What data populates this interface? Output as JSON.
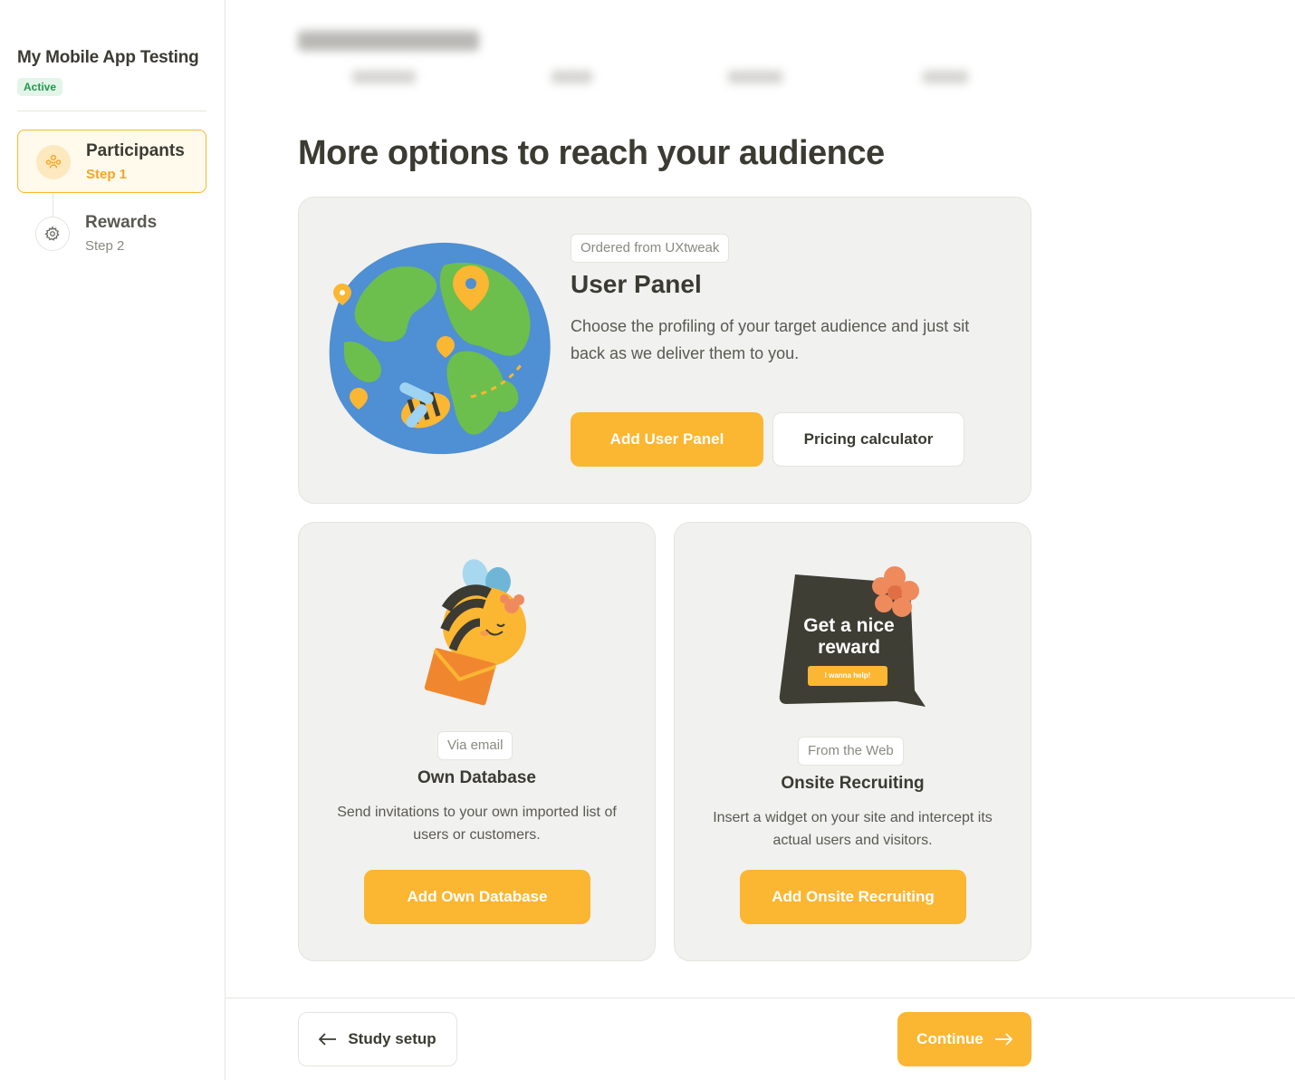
{
  "sidebar": {
    "study_title": "My Mobile App Testing",
    "status": "Active",
    "steps": [
      {
        "name": "Participants",
        "sub": "Step 1",
        "icon": "people-icon",
        "active": true
      },
      {
        "name": "Rewards",
        "sub": "Step 2",
        "icon": "gear-icon",
        "active": false
      }
    ]
  },
  "main": {
    "heading": "More options to reach your audience",
    "user_panel": {
      "tag": "Ordered from UXtweak",
      "title": "User Panel",
      "description": "Choose the profiling of your target audience and just sit back as we deliver them to you.",
      "primary_button": "Add User Panel",
      "secondary_button": "Pricing calculator"
    },
    "own_database": {
      "tag": "Via email",
      "title": "Own Database",
      "description": "Send invitations to your own imported list of users or customers.",
      "button": "Add Own Database"
    },
    "onsite": {
      "tag": "From the Web",
      "title": "Onsite Recruiting",
      "description": "Insert a widget on your site and intercept its actual users and visitors.",
      "button": "Add Onsite Recruiting",
      "illustration_text": "Get a nice reward",
      "illustration_button": "I wanna help!"
    }
  },
  "footer": {
    "back_label": "Study setup",
    "continue_label": "Continue"
  },
  "colors": {
    "accent": "#fbb632",
    "active_green": "#1f9a4f",
    "card_bg": "#f1f1ef",
    "text_dark": "#3b3a33"
  }
}
